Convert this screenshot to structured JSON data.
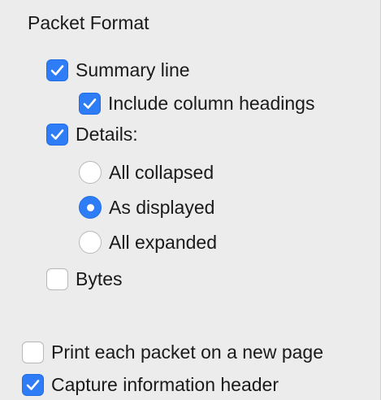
{
  "section": {
    "title": "Packet Format"
  },
  "options": {
    "summary_line": {
      "label": "Summary line",
      "checked": true
    },
    "include_column_headings": {
      "label": "Include column headings",
      "checked": true
    },
    "details": {
      "label": "Details:",
      "checked": true
    },
    "details_mode": {
      "selected": "As displayed",
      "choices": [
        {
          "label": "All collapsed",
          "selected": false
        },
        {
          "label": "As displayed",
          "selected": true
        },
        {
          "label": "All expanded",
          "selected": false
        }
      ]
    },
    "bytes": {
      "label": "Bytes",
      "checked": false
    }
  },
  "print_options": {
    "new_page": {
      "label": "Print each packet on a new page",
      "checked": false
    },
    "capture_header": {
      "label": "Capture information header",
      "checked": true
    }
  },
  "colors": {
    "accent": "#2e7df6",
    "background": "#ececec"
  }
}
